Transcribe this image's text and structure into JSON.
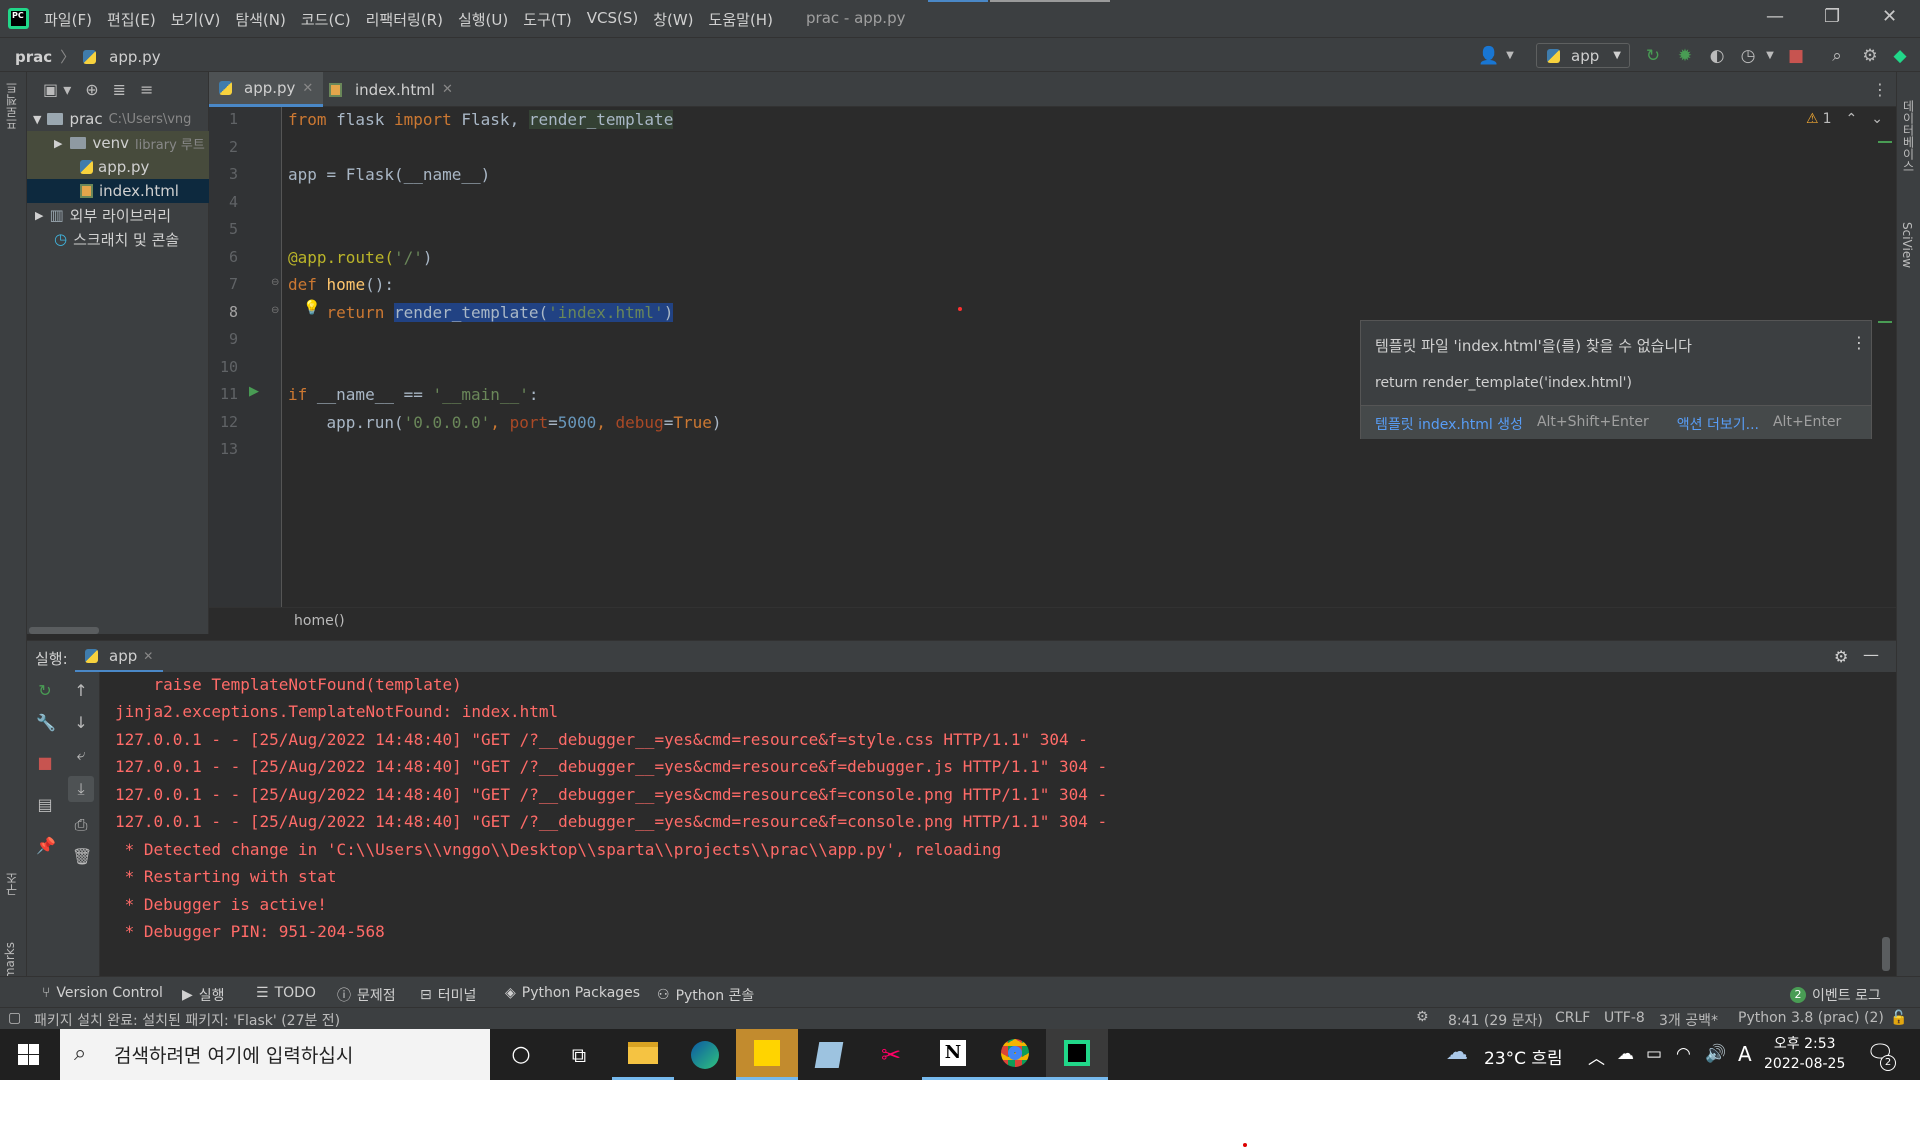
{
  "window": {
    "title": "prac - app.py",
    "menu": [
      "파일(F)",
      "편집(E)",
      "보기(V)",
      "탐색(N)",
      "코드(C)",
      "리팩터링(R)",
      "실행(U)",
      "도구(T)",
      "VCS(S)",
      "창(W)",
      "도움말(H)"
    ]
  },
  "navbar": {
    "project": "prac",
    "file": "app.py",
    "run_config": "app"
  },
  "left_stripe": {
    "project_label": "프로젝트",
    "structure_label": "구조",
    "bookmarks_label": "Bookmarks"
  },
  "right_stripe": {
    "database_label": "데이터베이스",
    "sciview_label": "SciView"
  },
  "project_tree": {
    "root": {
      "name": "prac",
      "hint": "C:\\Users\\vng"
    },
    "venv": {
      "name": "venv",
      "hint": "library 루트"
    },
    "files": [
      "app.py",
      "index.html"
    ],
    "external": "외부 라이브러리",
    "scratches": "스크래치 및 콘솔"
  },
  "tabs": [
    {
      "label": "app.py",
      "active": true
    },
    {
      "label": "index.html",
      "active": false
    }
  ],
  "editor": {
    "warning_count": "1",
    "line_numbers": [
      "1",
      "2",
      "3",
      "4",
      "5",
      "6",
      "7",
      "8",
      "9",
      "10",
      "11",
      "12",
      "13"
    ],
    "lines": {
      "l1": {
        "kw": "from",
        "mod": " flask ",
        "kw2": "import",
        "a": " Flask, ",
        "b": "render_template"
      },
      "l3": "app = Flask(__name__)",
      "l6": {
        "dec": "@app.route(",
        "str": "'/'",
        "end": ")"
      },
      "l7": {
        "kw": "def",
        "fn": " home",
        "end": "():"
      },
      "l8": {
        "kw": "    return ",
        "call": "render_template(",
        "str": "'index.html'",
        "end": ")"
      },
      "l11": {
        "kw": "if",
        "a": " __name__ == ",
        "str": "'__main__'",
        "end": ":"
      },
      "l12": {
        "a": "    app.run(",
        "s1": "'0.0.0.0'",
        "b": ", ",
        "p1": "port",
        "c": "=",
        "n1": "5000",
        "d": ", ",
        "p2": "debug",
        "e": "=",
        "k": "True",
        "f": ")"
      }
    },
    "breadcrumb": "home()"
  },
  "tooltip": {
    "message": "템플릿 파일 'index.html'을(를) 찾을 수 없습니다",
    "code": "return render_template('index.html')",
    "action1": "템플릿 index.html 생성",
    "shortcut1": "Alt+Shift+Enter",
    "action2": "액션 더보기...",
    "shortcut2": "Alt+Enter"
  },
  "run_panel": {
    "label": "실행:",
    "tab": "app",
    "console": [
      "    raise TemplateNotFound(template)",
      "jinja2.exceptions.TemplateNotFound: index.html",
      "127.0.0.1 - - [25/Aug/2022 14:48:40] \"GET /?__debugger__=yes&cmd=resource&f=style.css HTTP/1.1\" 304 -",
      "127.0.0.1 - - [25/Aug/2022 14:48:40] \"GET /?__debugger__=yes&cmd=resource&f=debugger.js HTTP/1.1\" 304 -",
      "127.0.0.1 - - [25/Aug/2022 14:48:40] \"GET /?__debugger__=yes&cmd=resource&f=console.png HTTP/1.1\" 304 -",
      "127.0.0.1 - - [25/Aug/2022 14:48:40] \"GET /?__debugger__=yes&cmd=resource&f=console.png HTTP/1.1\" 304 -",
      " * Detected change in 'C:\\\\Users\\\\vnggo\\\\Desktop\\\\sparta\\\\projects\\\\prac\\\\app.py', reloading",
      " * Restarting with stat",
      " * Debugger is active!",
      " * Debugger PIN: 951-204-568"
    ]
  },
  "tool_windows": [
    "Version Control",
    "실행",
    "TODO",
    "문제점",
    "터미널",
    "Python Packages",
    "Python 콘솔"
  ],
  "event_log": {
    "count": "2",
    "label": "이벤트 로그"
  },
  "status": {
    "message": "패키지 설치 완료: 설치된 패키지: 'Flask' (27분 전)",
    "position": "8:41 (29 문자)",
    "line_sep": "CRLF",
    "encoding": "UTF-8",
    "indent": "3개 공백*",
    "interpreter": "Python 3.8 (prac) (2)"
  },
  "taskbar": {
    "search_placeholder": "검색하려면 여기에 입력하십시",
    "weather": "23°C 흐림",
    "ime": "A",
    "time": "오후 2:53",
    "date": "2022-08-25",
    "notifications": "2"
  },
  "colors": {
    "accent": "#4a88c7",
    "error": "#ff6b68",
    "run_green": "#499c54",
    "stop_red": "#c75450"
  }
}
